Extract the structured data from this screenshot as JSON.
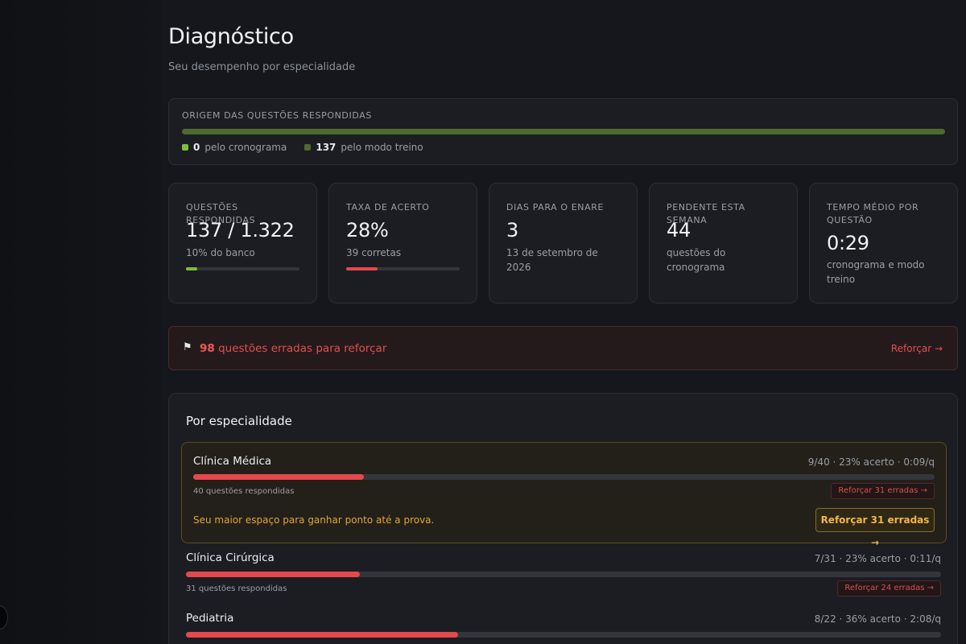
{
  "header": {
    "title": "Diagnóstico",
    "subtitle": "Seu desempenho por especialidade"
  },
  "origin": {
    "title": "ORIGEM DAS QUESTÕES RESPONDIDAS",
    "schedule": {
      "count": "0",
      "label": "pelo cronograma",
      "color": "#7bbf3b"
    },
    "training": {
      "count": "137",
      "label": "pelo modo treino",
      "color": "#4e6a30"
    },
    "bar_color": "#4e6a30"
  },
  "stats": [
    {
      "label": "QUESTÕES RESPONDIDAS",
      "value": "137 / 1.322",
      "sub": "10% do banco",
      "progress": 0.1,
      "bar_color": "#7bbf3b"
    },
    {
      "label": "TAXA DE ACERTO",
      "value": "28%",
      "sub": "39 corretas",
      "progress": 0.28,
      "bar_color": "#e5484d"
    },
    {
      "label": "DIAS PARA O ENARE",
      "value": "3",
      "sub": "13 de setembro de 2026"
    },
    {
      "label": "PENDENTE ESTA SEMANA",
      "value": "44",
      "sub": "questões do cronograma"
    },
    {
      "label": "TEMPO MÉDIO POR QUESTÃO",
      "value": "0:29",
      "sub": "cronograma e modo treino"
    }
  ],
  "alert": {
    "icon": "flag-icon",
    "count": "98",
    "text": "questões erradas para reforçar",
    "link": "Reforçar →"
  },
  "specialties": {
    "title": "Por especialidade",
    "rows": [
      {
        "name": "Clínica Médica",
        "stats": "9/40 · 23% acerto · 0:09/q",
        "progress": 0.23,
        "count": "40 questões respondidas",
        "button": "Reforçar 31 erradas →",
        "hint": "Seu maior espaço para ganhar ponto até a prova.",
        "cta": "Reforçar 31 erradas →"
      },
      {
        "name": "Clínica Cirúrgica",
        "stats": "7/31 · 23% acerto · 0:11/q",
        "progress": 0.23,
        "count": "31 questões respondidas",
        "button": "Reforçar 24 erradas →"
      },
      {
        "name": "Pediatria",
        "stats": "8/22 · 36% acerto · 2:08/q",
        "progress": 0.36
      }
    ]
  },
  "colors": {
    "accent_red": "#e5484d",
    "accent_green": "#7bbf3b",
    "accent_amber": "#f0b54a",
    "background": "#15171c"
  }
}
